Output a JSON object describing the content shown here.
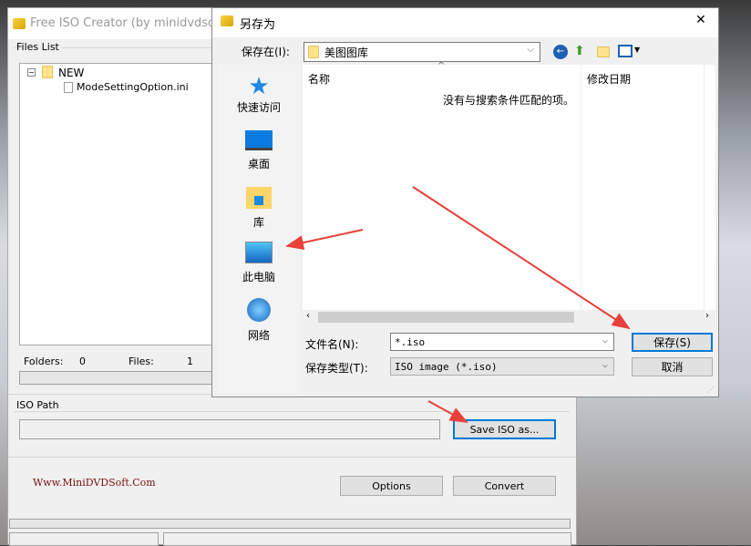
{
  "main_window": {
    "title": "Free ISO Creator (by minidvdsoft)",
    "files_list_label": "Files List",
    "tree": {
      "root": "NEW",
      "children": [
        "ModeSettingOption.ini"
      ]
    },
    "folders_label": "Folders:",
    "folders_count": "0",
    "files_label": "Files:",
    "files_count": "1",
    "iso_path_label": "ISO Path",
    "iso_path_value": "",
    "save_iso_button": "Save ISO as...",
    "website": "Www.MiniDVDSoft.Com",
    "options_button": "Options",
    "convert_button": "Convert"
  },
  "dialog": {
    "title": "另存为",
    "close": "✕",
    "save_in_label": "保存在(I):",
    "save_in_value": "美图图库",
    "places": [
      {
        "label": "快速访问",
        "icon": "star-icon"
      },
      {
        "label": "桌面",
        "icon": "desktop-icon"
      },
      {
        "label": "库",
        "icon": "library-icon"
      },
      {
        "label": "此电脑",
        "icon": "computer-icon"
      },
      {
        "label": "网络",
        "icon": "network-icon"
      }
    ],
    "columns": [
      "名称",
      "修改日期"
    ],
    "empty_message": "没有与搜索条件匹配的项。",
    "filename_label": "文件名(N):",
    "filename_value": "*.iso",
    "filetype_label": "保存类型(T):",
    "filetype_value": "ISO image (*.iso)",
    "save_button": "保存(S)",
    "cancel_button": "取消"
  },
  "colors": {
    "accent": "#0078d7",
    "arrow": "#e8403a",
    "website": "#7a1010"
  }
}
